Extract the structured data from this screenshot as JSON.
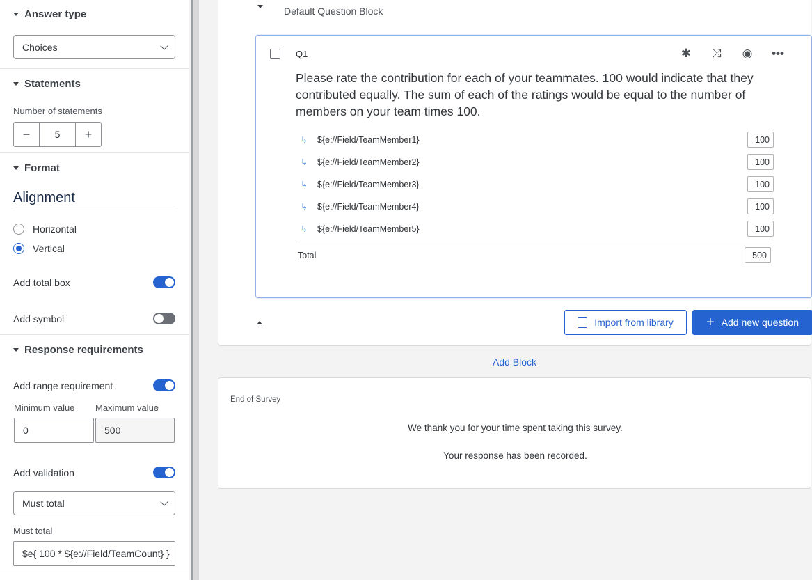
{
  "sidebar": {
    "answer_type": {
      "title": "Answer type",
      "value": "Choices"
    },
    "statements": {
      "title": "Statements",
      "count_label": "Number of statements",
      "count": "5"
    },
    "format": {
      "title": "Format",
      "alignment_title": "Alignment",
      "options": [
        {
          "label": "Horizontal",
          "selected": false
        },
        {
          "label": "Vertical",
          "selected": true
        }
      ],
      "add_total_box": {
        "label": "Add total box",
        "on": true
      },
      "add_symbol": {
        "label": "Add symbol",
        "on": false
      }
    },
    "response": {
      "title": "Response requirements",
      "add_range": {
        "label": "Add range requirement",
        "on": true
      },
      "min_label": "Minimum value",
      "max_label": "Maximum value",
      "min_value": "0",
      "max_value": "500",
      "add_validation": {
        "label": "Add validation",
        "on": true
      },
      "validation_type": "Must total",
      "must_total_label": "Must total",
      "must_total_value": "$e{ 100 * ${e://Field/TeamCount} }"
    }
  },
  "main": {
    "block_title": "Default Question Block",
    "question": {
      "number": "Q1",
      "text": "Please rate the contribution for each of your teammates. 100 would indicate that they contributed equally. The sum of each of the ratings would be equal to the number of members on your team times 100.",
      "statements": [
        {
          "label": "${e://Field/TeamMember1}",
          "value": "100"
        },
        {
          "label": "${e://Field/TeamMember2}",
          "value": "100"
        },
        {
          "label": "${e://Field/TeamMember3}",
          "value": "100"
        },
        {
          "label": "${e://Field/TeamMember4}",
          "value": "100"
        },
        {
          "label": "${e://Field/TeamMember5}",
          "value": "100"
        }
      ],
      "total_label": "Total",
      "total_value": "500"
    },
    "import_label": "Import from library",
    "add_question_label": "Add new question",
    "add_block_label": "Add Block",
    "end_survey": {
      "title": "End of Survey",
      "line1": "We thank you for your time spent taking this survey.",
      "line2": "Your response has been recorded."
    }
  },
  "colors": {
    "accent": "#2563d1",
    "sidebar_divider": "#9b9ea3"
  }
}
